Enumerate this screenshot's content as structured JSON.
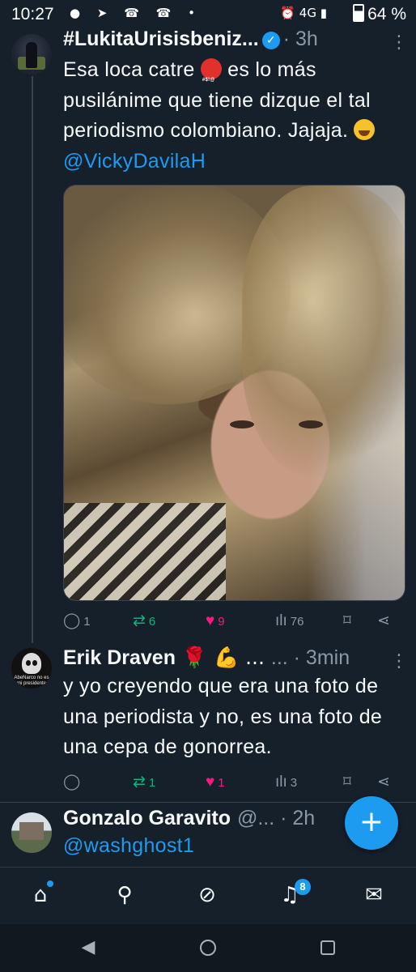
{
  "status_bar": {
    "time": "10:27",
    "notification_icons": "● ➤ ☎ ☎ •",
    "system_icons": "⏰ 4G ▮",
    "battery": "64 %"
  },
  "tweets": [
    {
      "author_name": "#LukitaUrisisbeniz...",
      "verified": true,
      "time": "· 3h",
      "text_before": "Esa loca catre",
      "text_after": " es lo más pusilánime que tiene dizque el tal periodismo colombiano. Jajaja. ",
      "mention": "@VickyDavilaH",
      "has_photo": true,
      "replies": "1",
      "reposts": "6",
      "likes": "9",
      "views": "76"
    },
    {
      "author_name": "Erik Draven",
      "author_emojis": "🌹 💪 ...",
      "time": "... · 3min",
      "text": "y yo creyendo que era una foto de una periodista y no, es una foto de una cepa de gonorrea.",
      "avatar_caption": "AbeNarco no es mi presidente",
      "replies": "",
      "reposts": "1",
      "likes": "1",
      "views": "3"
    },
    {
      "author_name": "Gonzalo Garavito",
      "handle_partial": "@... · 2h",
      "text": "@washghost1"
    }
  ],
  "fab_label": "+",
  "tabbar": {
    "notifications_badge": "8"
  },
  "colors": {
    "background": "#15202b",
    "accent": "#1d9bf0",
    "repost": "#00ba7c",
    "like": "#f91880",
    "muted": "#8b98a5"
  }
}
